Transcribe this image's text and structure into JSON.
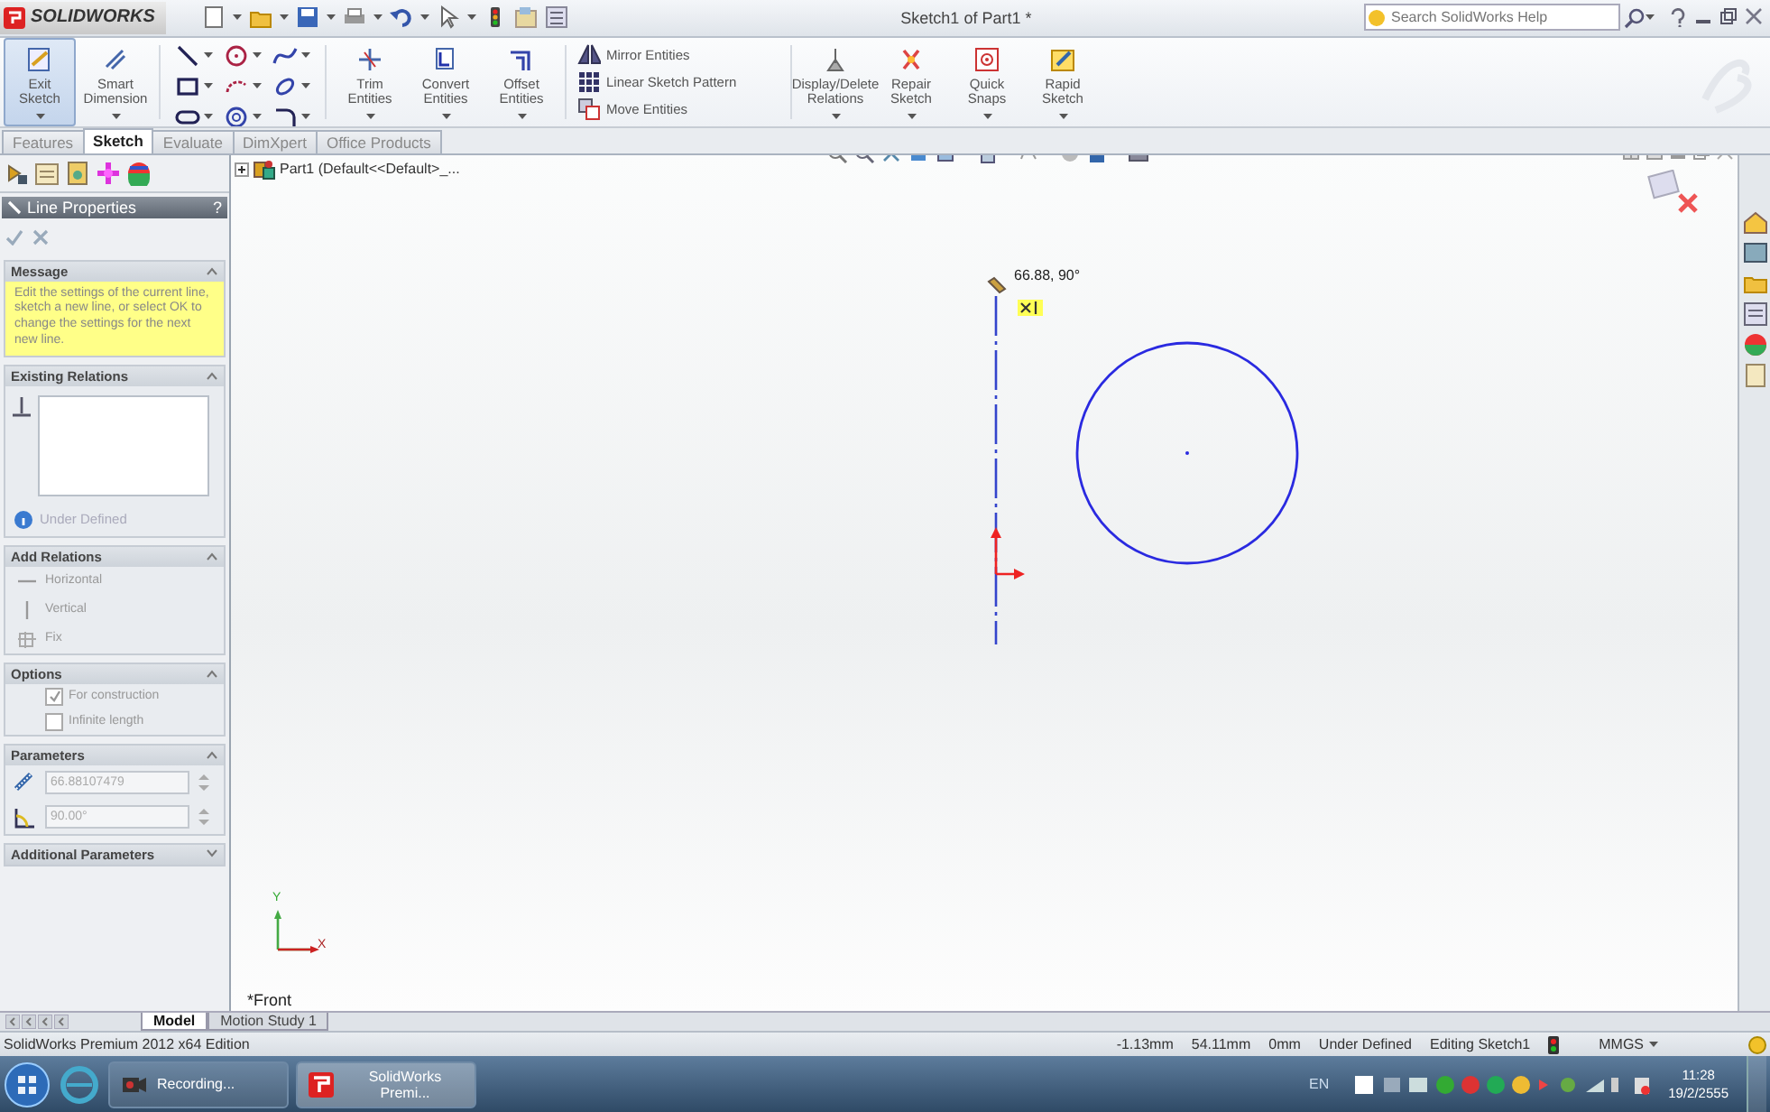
{
  "title_bar": {
    "logo": "SOLIDWORKS",
    "title": "Sketch1 of Part1 *",
    "search": {
      "placeholder": "Search SolidWorks Help"
    }
  },
  "ribbon": [
    {
      "kind": "big",
      "label": "Exit Sketch",
      "selected": true
    },
    {
      "kind": "big",
      "label": "Smart Dimension",
      "selected": false
    },
    {
      "kind": "tools"
    },
    {
      "kind": "big",
      "label": "Trim Entities",
      "selected": false
    },
    {
      "kind": "big",
      "label": "Convert Entities",
      "selected": false
    },
    {
      "kind": "big",
      "label": "Offset Entities",
      "selected": false
    },
    {
      "kind": "list",
      "entries": [
        "Mirror Entities",
        "Linear Sketch Pattern",
        "Move Entities"
      ]
    },
    {
      "kind": "big",
      "label": "Display/Delete Relations",
      "selected": false
    },
    {
      "kind": "big",
      "label": "Repair Sketch",
      "selected": false
    },
    {
      "kind": "big",
      "label": "Quick Snaps",
      "selected": false
    },
    {
      "kind": "big",
      "label": "Rapid Sketch",
      "selected": false
    }
  ],
  "command_tabs": [
    {
      "label": "Features",
      "selected": false
    },
    {
      "label": "Sketch",
      "selected": true
    },
    {
      "label": "Evaluate",
      "selected": false
    },
    {
      "label": "DimXpert",
      "selected": false
    },
    {
      "label": "Office Products",
      "selected": false
    }
  ],
  "feature_tree": {
    "root": "Part1  (Default<<Default>_..."
  },
  "property_manager": {
    "title": "Line Properties",
    "help": "?",
    "sections": [
      {
        "kind": "message",
        "title": "Message",
        "expanded": true,
        "text": "Edit the settings of the current line, sketch a new line, or select OK to change the settings for the next new line."
      },
      {
        "kind": "relations",
        "title": "Existing Relations",
        "expanded": true,
        "status": "Under Defined"
      },
      {
        "kind": "list",
        "title": "Add Relations",
        "expanded": true,
        "items": [
          "Horizontal",
          "Vertical",
          "Fix"
        ]
      },
      {
        "kind": "checks",
        "title": "Options",
        "expanded": true,
        "items": [
          {
            "label": "For construction",
            "checked": true
          },
          {
            "label": "Infinite length",
            "checked": false
          }
        ]
      },
      {
        "kind": "params",
        "title": "Parameters",
        "expanded": true,
        "fields": [
          "66.88107479",
          "90.00°"
        ]
      },
      {
        "title": "Additional Parameters",
        "expanded": false
      }
    ]
  },
  "canvas": {
    "dimension": "66.88, 90°",
    "axis_labels": [
      "Y",
      "X"
    ],
    "view_name": "*Front"
  },
  "bottom_tabs": [
    {
      "label": "Model",
      "selected": true
    },
    {
      "label": "Motion Study 1",
      "selected": false
    }
  ],
  "status_bar": {
    "edition": "SolidWorks Premium 2012 x64 Edition",
    "fields": [
      "-1.13mm",
      "54.11mm",
      "0mm",
      "Under Defined",
      "Editing Sketch1"
    ],
    "units": "MMGS"
  },
  "taskbar": {
    "windows": [
      {
        "label": "Recording...",
        "selected": false
      },
      {
        "label": "SolidWorks Premi...",
        "selected": true
      }
    ],
    "language": "EN",
    "time": "11:28",
    "date": "19/2/2555"
  }
}
